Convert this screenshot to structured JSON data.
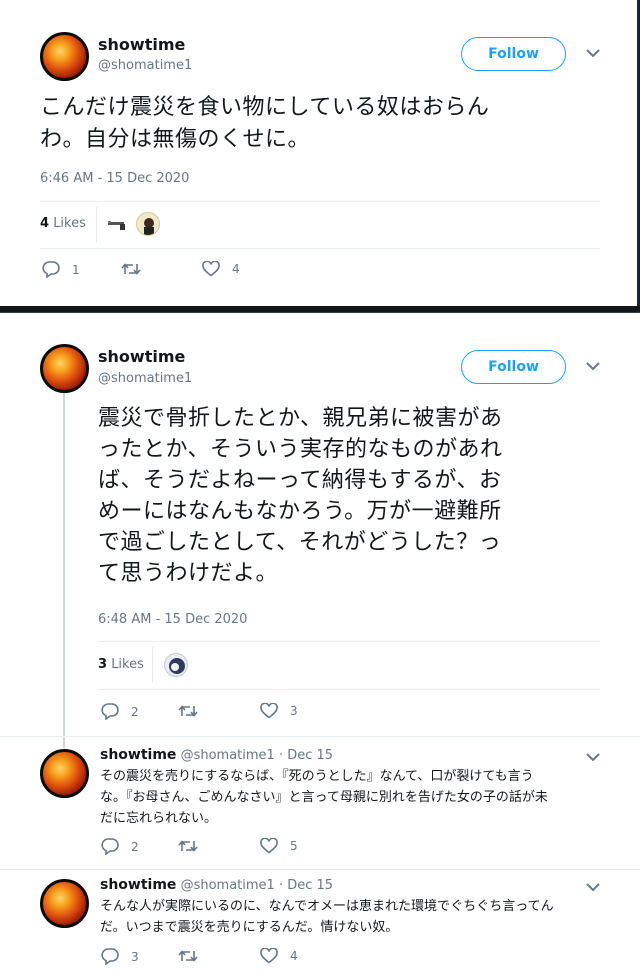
{
  "tweet1": {
    "name": "showtime",
    "handle": "@shomatime1",
    "follow_label": "Follow",
    "text_line1": "こんだけ震災を食い物にしている奴はおらん",
    "text_line2": "わ。自分は無傷のくせに。",
    "timestamp": "6:46 AM - 15 Dec 2020",
    "likes_count": "4",
    "likes_label": "Likes",
    "reply_count": "1",
    "retweet_count": "",
    "like_count": "4"
  },
  "tweet2": {
    "name": "showtime",
    "handle": "@shomatime1",
    "follow_label": "Follow",
    "text_lines": [
      "震災で骨折したとか、親兄弟に被害があ",
      "ったとか、そういう実存的なものがあれ",
      "ば、そうだよねーって納得もするが、お",
      "めーにはなんもなかろう。万が一避難所",
      "で過ごしたとして、それがどうした？っ",
      "て思うわけだよ。"
    ],
    "timestamp": "6:48 AM - 15 Dec 2020",
    "likes_count": "3",
    "likes_label": "Likes",
    "reply_count": "2",
    "retweet_count": "",
    "like_count": "3"
  },
  "reply1": {
    "name": "showtime",
    "handle": "@shomatime1",
    "date": "· Dec 15",
    "text_lines": [
      "その震災を売りにするならば、『死のうとした』なんて、口が裂けても言う",
      "な。『お母さん、ごめんなさい』と言って母親に別れを告げた女の子の話が未",
      "だに忘れられない。"
    ],
    "reply_count": "2",
    "retweet_count": "",
    "like_count": "5"
  },
  "reply2": {
    "name": "showtime",
    "handle": "@shomatime1",
    "date": "· Dec 15",
    "text_lines": [
      "そんな人が実際にいるのに、なんでオメーは恵まれた環境でぐちぐち言ってん",
      "だ。いつまで震災を売りにするんだ。情けない奴。"
    ],
    "reply_count": "3",
    "retweet_count": "",
    "like_count": "4"
  },
  "colors": {
    "accent": "#1da1f2",
    "muted": "#657786",
    "text": "#14171a",
    "divider": "#e6ecf0"
  },
  "icons": [
    "avatar",
    "chevron-down-icon",
    "reply-icon",
    "retweet-icon",
    "heart-icon"
  ]
}
